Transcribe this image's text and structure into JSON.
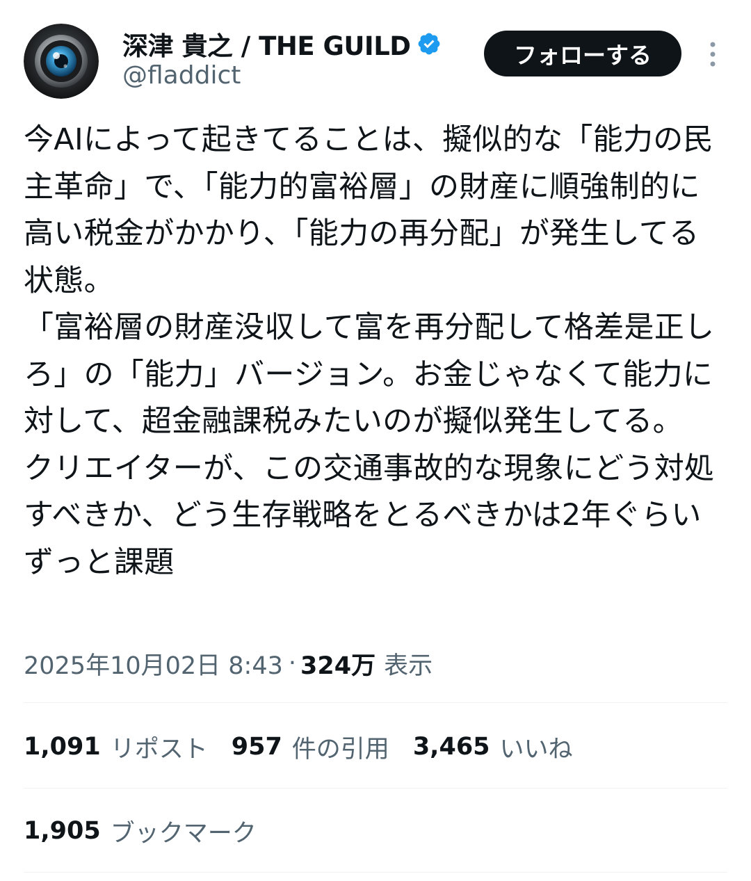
{
  "author": {
    "display_name": "深津 貴之 / THE GUILD",
    "handle": "@fladdict",
    "verified_color": "#1d9bf0",
    "avatar_icon": "camera-lens-avatar"
  },
  "header": {
    "follow_label": "フォローする",
    "more_icon": "more-vertical-icon"
  },
  "tweet": {
    "text": "今AIによって起きてることは、擬似的な「能力の民主革命」で、「能力的富裕層」の財産に順強制的に高い税金がかかり、「能力の再分配」が発生してる状態。\n「富裕層の財産没収して富を再分配して格差是正しろ」の「能力」バージョン。お金じゃなくて能力に対して、超金融課税みたいのが擬似発生してる。\nクリエイターが、この交通事故的な現象にどう対処すべきか、どう生存戦略をとるべきかは2年ぐらいずっと課題",
    "timestamp": "2025年10月02日 8:43",
    "separator": "·",
    "views_count": "324万",
    "views_label": "表示"
  },
  "stats": {
    "reposts": {
      "count": "1,091",
      "label": "リポスト"
    },
    "quotes": {
      "count": "957",
      "label": "件の引用"
    },
    "likes": {
      "count": "3,465",
      "label": "いいね"
    },
    "bookmarks": {
      "count": "1,905",
      "label": "ブックマーク"
    }
  },
  "colors": {
    "text_primary": "#0f1419",
    "text_secondary": "#536471",
    "divider": "#eff3f4",
    "button_bg": "#0f1419"
  }
}
